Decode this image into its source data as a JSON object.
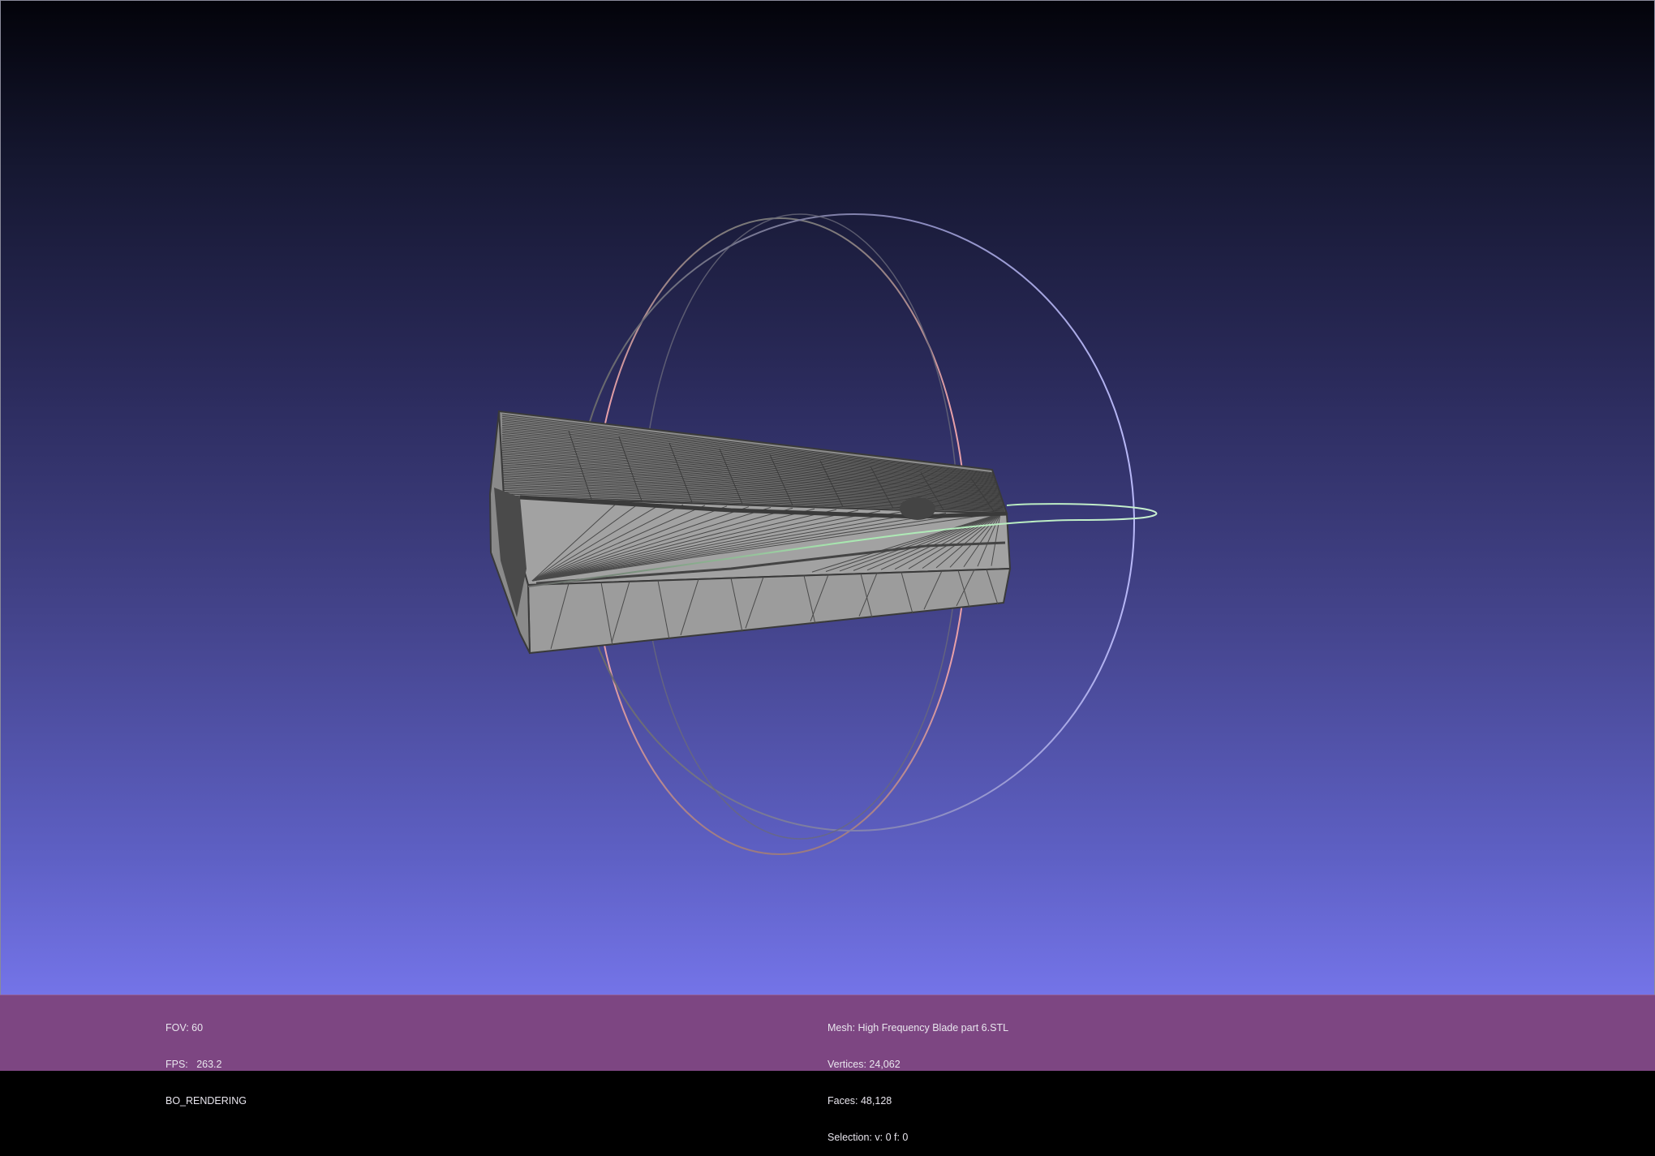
{
  "viewport": {
    "background_top_color": "#03030a",
    "background_bottom_color": "#7878ee",
    "status_bar_color": "#7d4682"
  },
  "render_info": {
    "fov": "FOV: 60",
    "fps": "FPS:   263.2",
    "mode": "BO_RENDERING"
  },
  "mesh_info": {
    "mesh": "Mesh: High Frequency Blade part 6.STL",
    "vertices": "Vertices: 24,062",
    "faces": "Faces: 48,128",
    "selection": "Selection: v: 0 f: 0"
  },
  "trackball": {
    "x_ring_color": "#e8a0a8",
    "y_ring_color": "#a8e8b0",
    "z_ring_color": "#b0b0f0"
  },
  "mesh_render": {
    "face_color": "#9a9a9a",
    "edge_color": "#3a3a3a"
  }
}
